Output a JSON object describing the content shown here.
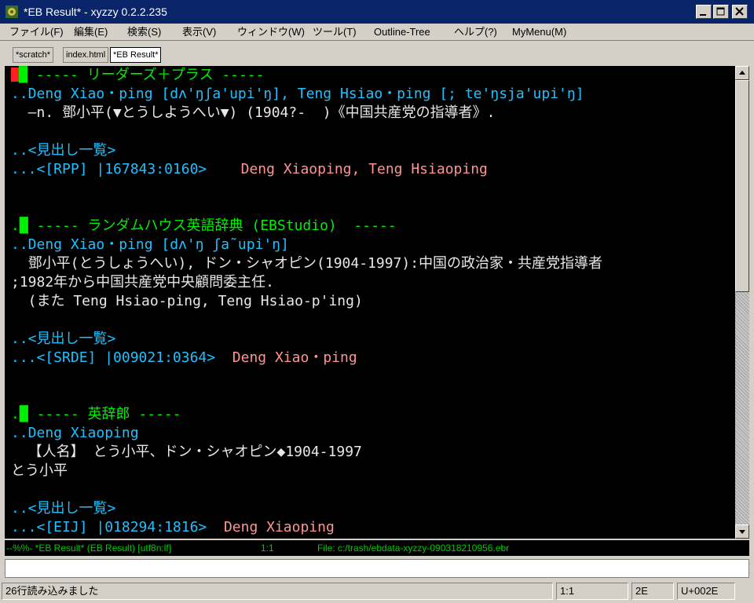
{
  "window": {
    "title": "*EB Result* - xyzzy 0.2.2.235"
  },
  "menu": [
    "ファイル(F)",
    "編集(E)",
    "検索(S)",
    "表示(V)",
    "ウィンドウ(W)",
    "ツール(T)",
    "Outline-Tree",
    "ヘルプ(?)",
    "MyMenu(M)"
  ],
  "tabs": [
    {
      "label": "*scratch*"
    },
    {
      "label": "index.html"
    },
    {
      "label": "*EB Result*"
    }
  ],
  "buffer": {
    "entries": [
      {
        "header": "----- リーダーズ＋プラス -----",
        "headword": "..Deng Xiao・ping [dʌ'ŋʃa'upi'ŋ], Teng Hsiao・ping [; te'ŋsja'upi'ŋ]",
        "body": [
          "  ―n. 鄧小平(▼とうしようへい▼) (1904?-  )《中国共産党の指導者》."
        ],
        "index_label": "..<見出し一覧>",
        "ref_code": "...<[RPP] |167843:0160>",
        "ref_title": "Deng Xiaoping, Teng Hsiaoping"
      },
      {
        "header": "----- ランダムハウス英語辞典 (EBStudio)  -----",
        "headword": "..Deng Xiao・ping [dʌ'ŋ ʃa˜upi'ŋ]",
        "body": [
          "  鄧小平(とうしょうへい), ドン・シャオピン(1904-1997):中国の政治家・共産党指導者",
          ";1982年から中国共産党中央顧問委主任.",
          "  (また Teng Hsiao-ping, Teng Hsiao-p'ing)"
        ],
        "index_label": "..<見出し一覧>",
        "ref_code": "...<[SRDE] |009021:0364>",
        "ref_title": "Deng Xiao・ping"
      },
      {
        "header": "----- 英辞郎 -----",
        "headword": "..Deng Xiaoping",
        "body": [
          "  【人名】 とう小平、ドン・シャオピン◆1904-1997",
          "とう小平"
        ],
        "index_label": "..<見出し一覧>",
        "ref_code": "...<[EIJ] |018294:1816>",
        "ref_title": "Deng Xiaoping"
      }
    ]
  },
  "modeline": {
    "status": "--%%- *EB Result* (EB Result) [utf8n:lf]",
    "position": "1:1",
    "file": "File: c:/trash/ebdata-xyzzy-090318210956.ebr"
  },
  "statusbar": {
    "message": "26行読み込みました",
    "position": "1:1",
    "char_hex": "2E",
    "codepoint": "U+002E"
  },
  "colors": {
    "header": "#00ee00",
    "headword": "#20c0ff",
    "reference_title": "#ff9494",
    "body_text": "#e8e8e8",
    "cursor": "#ff2020"
  }
}
